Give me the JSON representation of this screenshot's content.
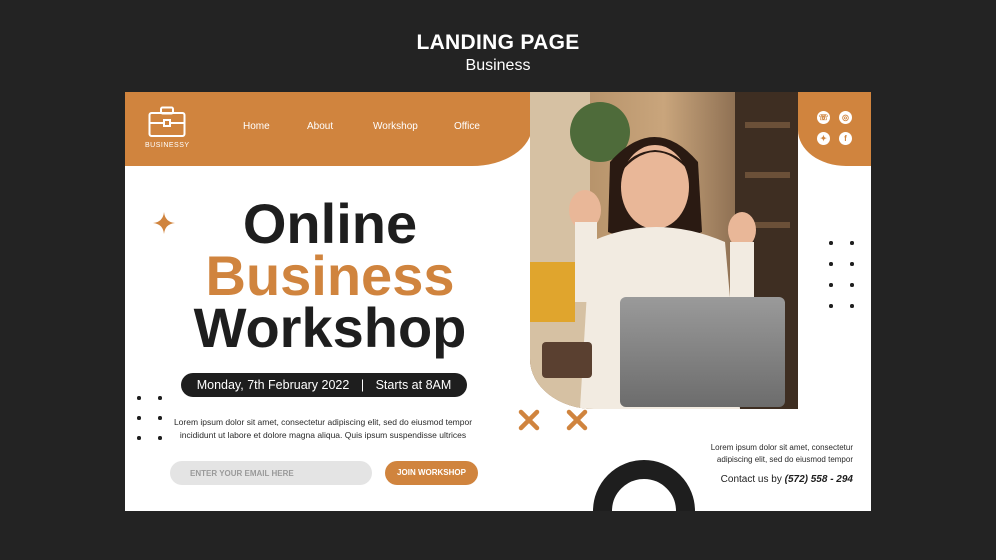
{
  "header": {
    "title": "LANDING PAGE",
    "subtitle": "Business"
  },
  "logo": {
    "label": "BUSINESSY",
    "icon": "briefcase-icon"
  },
  "nav": [
    {
      "label": "Home"
    },
    {
      "label": "About"
    },
    {
      "label": "Workshop"
    },
    {
      "label": "Office"
    }
  ],
  "social": [
    {
      "icon": "whatsapp-icon",
      "glyph": "☏"
    },
    {
      "icon": "instagram-icon",
      "glyph": "◎"
    },
    {
      "icon": "twitter-icon",
      "glyph": "✦"
    },
    {
      "icon": "facebook-icon",
      "glyph": "f"
    }
  ],
  "hero": {
    "line1": "Online",
    "line2": "Business",
    "line3": "Workshop",
    "date": "Monday, 7th February 2022",
    "separator": "|",
    "time": "Starts at 8AM",
    "body_line1": "Lorem ipsum dolor sit amet, consectetur  adipiscing elit, sed do eiusmod tempor",
    "body_line2": "incididunt ut labore et dolore magna aliqua. Quis ipsum suspendisse ultrices"
  },
  "form": {
    "email_placeholder": "ENTER YOUR EMAIL HERE",
    "button_label": "JOIN WORKSHOP"
  },
  "right": {
    "text_line1": "Lorem ipsum dolor sit amet, consectetur",
    "text_line2": "adipiscing elit, sed do eiusmod tempor",
    "contact_label": "Contact us by",
    "phone": "(572) 558 - 294"
  },
  "colors": {
    "accent": "#d0843e",
    "dark": "#1e1e1e",
    "background": "#232323"
  }
}
